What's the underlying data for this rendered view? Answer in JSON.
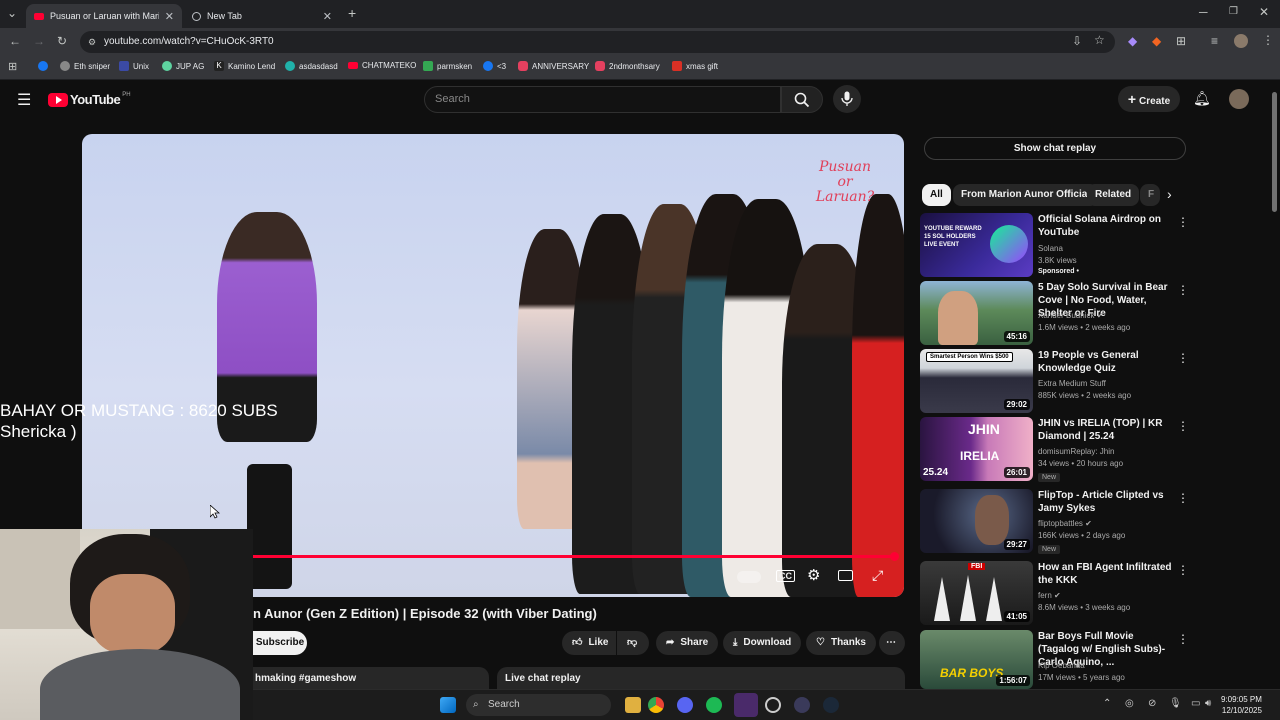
{
  "browser": {
    "tabs": [
      {
        "label": "Pusuan or Laruan with Marion A",
        "active": true
      },
      {
        "label": "New Tab",
        "active": false
      }
    ],
    "url": "youtube.com/watch?v=CHuOcK-3RT0",
    "bookmarks": [
      "Eth sniper",
      "Unix",
      "JUP AG",
      "Kamino Lend",
      "asdasdasd",
      "CHATMATEKO",
      "parmsken",
      "<3",
      "ANNIVERSARY",
      "2ndmonthsary",
      "xmas gift"
    ]
  },
  "youtube": {
    "logo_text": "YouTube",
    "region": "PH",
    "search_placeholder": "Search",
    "create_label": "Create",
    "overlay_line1": "BAHAY OR MUSTANG : 8620 SUBS",
    "overlay_line2": "Shericka )",
    "video_brand": "Pusuan or Laruan?",
    "video_title": "n Aunor (Gen Z Edition) | Episode 32 (with Viber Dating)",
    "subscribe_label": "Subscribe",
    "actions": {
      "like": "Like",
      "share": "Share",
      "download": "Download",
      "thanks": "Thanks"
    },
    "description_snippet": "hmaking #gameshow",
    "live_chat_label": "Live chat replay",
    "show_chat_label": "Show chat replay",
    "chips": [
      "All",
      "From Marion Aunor Official",
      "Related",
      "F"
    ],
    "recommendations": [
      {
        "title": "Official Solana Airdrop on YouTube",
        "channel": "Solana",
        "meta": "3.8K views",
        "extra": "Sponsored •",
        "duration": ""
      },
      {
        "title": "5 Day Solo Survival in Bear Cove | No Food, Water, Shelter or Fire",
        "channel": "Xander Budnick",
        "meta": "1.6M views • 2 weeks ago",
        "extra": "",
        "duration": "45:16"
      },
      {
        "title": "19 People vs General Knowledge Quiz",
        "channel": "Extra Medium Stuff",
        "meta": "885K views • 2 weeks ago",
        "extra": "",
        "duration": "29:02"
      },
      {
        "title": "JHIN vs IRELIA (TOP) | KR Diamond | 25.24",
        "channel": "domisumReplay: Jhin",
        "meta": "34 views • 20 hours ago",
        "extra": "New",
        "duration": "26:01"
      },
      {
        "title": "FlipTop - Article Clipted vs Jamy Sykes",
        "channel": "fliptopbattles",
        "meta": "166K views • 2 days ago",
        "extra": "New",
        "duration": "29:27"
      },
      {
        "title": "How an FBI Agent Infiltrated the KKK",
        "channel": "fern",
        "meta": "8.6M views • 3 weeks ago",
        "extra": "",
        "duration": "41:05"
      },
      {
        "title": "Bar Boys Full Movie (Tagalog w/ English Subs)- Carlo Aquino, ...",
        "channel": "Kip Oebanda",
        "meta": "17M views • 5 years ago",
        "extra": "",
        "duration": "1:56:07"
      }
    ],
    "thumb_texts": {
      "solana": "YOUTUBE REWARD 15 SOL HOLDERS LIVE EVENT",
      "quiz": "Smartest Person Wins $500",
      "jhin": "JHIN",
      "irelia": "IRELIA",
      "patch": "25.24",
      "fbi": "FBI",
      "barboys": "BAR BOYS"
    }
  },
  "taskbar": {
    "search_label": "Search",
    "time": "9:09:05 PM",
    "date": "12/10/2025"
  },
  "colors": {
    "accent": "#ff0033",
    "bg": "#0f0f0f"
  }
}
